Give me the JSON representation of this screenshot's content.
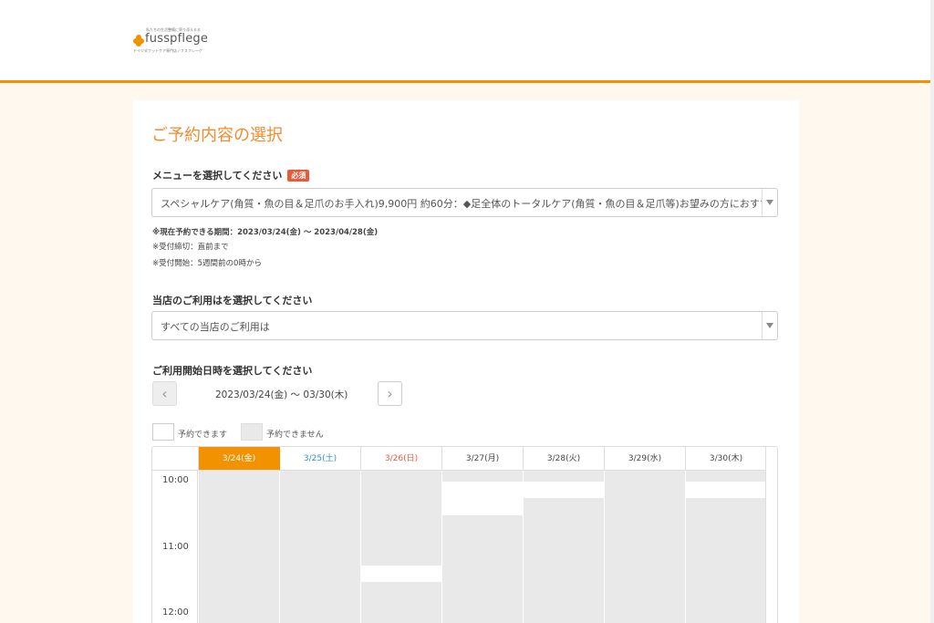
{
  "brand": {
    "tagline": "私たちの生活整備に寄り添えるる",
    "name": "fusspflege",
    "subtitle": "ドイツ式フットケア専門店 / フスフレーゲ",
    "accent": "#f39200"
  },
  "page": {
    "title": "ご予約内容の選択"
  },
  "menu_select": {
    "label": "メニューを選択してください",
    "required_badge": "必須",
    "value": "スペシャルケア(角質・魚の目＆足爪のお手入れ)9,900円 約60分：◆足全体のトータルケア(角質・魚の目＆足爪等)お望みの方におすすめ..."
  },
  "notes": {
    "period": "※現在予約できる期間：2023/03/24(金) ～ 2023/04/28(金)",
    "deadline": "※受付締切：直前まで",
    "start": "※受付開始：5週間前の0時から"
  },
  "usage_select": {
    "label": "当店のご利用はを選択してください",
    "value": "すべての当店のご利用は"
  },
  "datetime": {
    "label": "ご利用開始日時を選択してください",
    "range": "2023/03/24(金) ～ 03/30(木)",
    "prev_icon": "chevron-left-icon",
    "next_icon": "chevron-right-icon"
  },
  "legend": {
    "available": "予約できます",
    "unavailable": "予約できません"
  },
  "calendar": {
    "days": [
      {
        "label": "3/24(金)",
        "kind": "today"
      },
      {
        "label": "3/25(土)",
        "kind": "sat"
      },
      {
        "label": "3/26(日)",
        "kind": "sun"
      },
      {
        "label": "3/27(月)",
        "kind": "weekday"
      },
      {
        "label": "3/28(火)",
        "kind": "weekday"
      },
      {
        "label": "3/29(水)",
        "kind": "weekday"
      },
      {
        "label": "3/30(木)",
        "kind": "weekday"
      }
    ],
    "times": [
      "10:00",
      "11:00",
      "12:00"
    ],
    "colors": {
      "today": "#f39200",
      "saturday": "#2d8fd5",
      "sunday": "#e8593a",
      "unavailable": "#e9e9e9"
    }
  }
}
